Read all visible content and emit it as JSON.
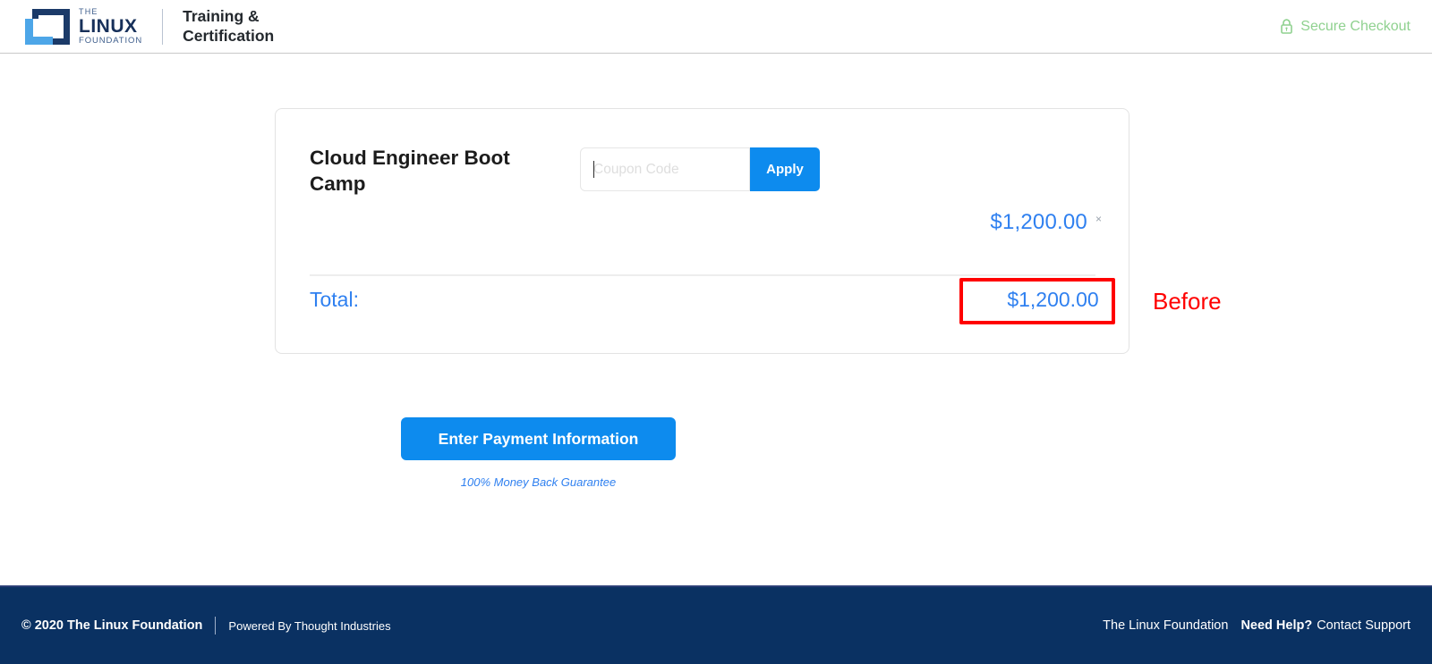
{
  "header": {
    "logo": {
      "the": "THE",
      "linux": "LINUX",
      "foundation": "FOUNDATION"
    },
    "title": "Training &\nCertification",
    "secure_label": "Secure Checkout",
    "lock_icon": "lock-icon"
  },
  "order": {
    "item_title": "Cloud Engineer Boot Camp",
    "coupon_placeholder": "Coupon Code",
    "coupon_value": "",
    "apply_label": "Apply",
    "item_price": "$1,200.00",
    "remove_icon": "×",
    "total_label": "Total:",
    "total_value": "$1,200.00"
  },
  "annotation": {
    "label": "Before",
    "color": "#ff0000"
  },
  "cta": {
    "button_label": "Enter Payment Information",
    "guarantee": "100% Money Back Guarantee"
  },
  "footer": {
    "copyright": "© 2020 The Linux Foundation",
    "powered_by": "Powered By Thought Industries",
    "org": "The Linux Foundation",
    "need_help": "Need Help?",
    "contact": "Contact Support"
  },
  "colors": {
    "primary_blue": "#0d8bee",
    "link_blue": "#2f80f0",
    "navy": "#0a3162",
    "green": "#8fd18f",
    "annotation_red": "#ff0000"
  }
}
